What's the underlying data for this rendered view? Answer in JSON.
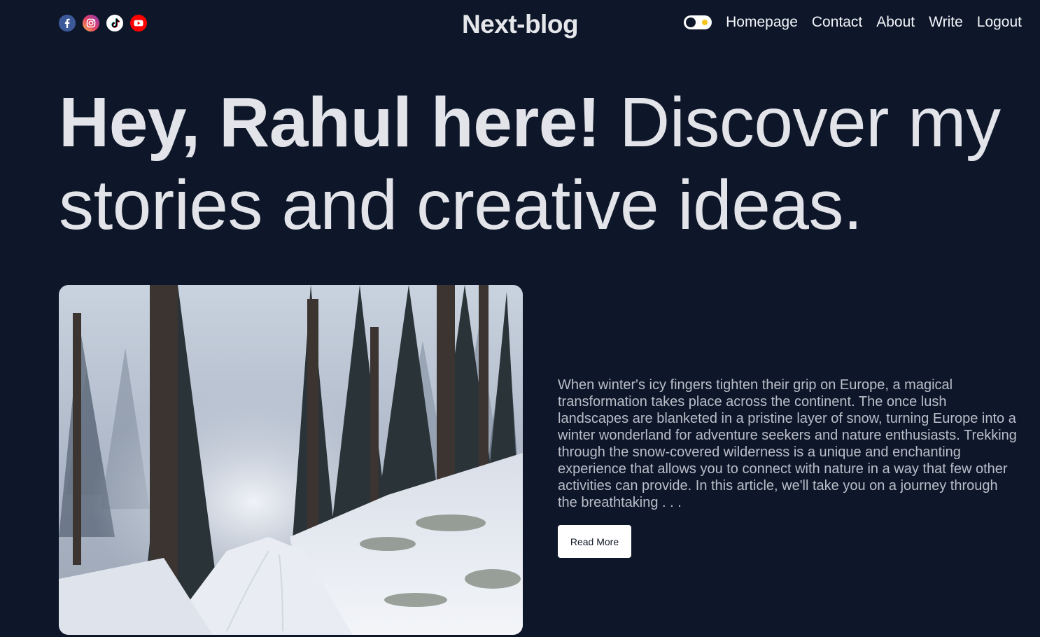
{
  "navbar": {
    "socials": [
      {
        "name": "facebook",
        "icon": "facebook-icon",
        "color": "#3b5998"
      },
      {
        "name": "instagram",
        "icon": "instagram-icon",
        "color": "#e1306c"
      },
      {
        "name": "tiktok",
        "icon": "tiktok-icon",
        "color": "#000000"
      },
      {
        "name": "youtube",
        "icon": "youtube-icon",
        "color": "#ff0000"
      }
    ],
    "logo": "Next-blog",
    "theme_toggle": {
      "state": "dark",
      "icon": "sun-icon"
    },
    "links": {
      "homepage": "Homepage",
      "contact": "Contact",
      "about": "About",
      "write": "Write",
      "logout": "Logout"
    }
  },
  "hero": {
    "bold": "Hey, Rahul here!",
    "rest": " Discover my stories and creative ideas."
  },
  "featured": {
    "image_alt": "snowy-forest-path-image",
    "excerpt": "When winter's icy fingers tighten their grip on Europe, a magical transformation takes place across the continent. The once lush landscapes are blanketed in a pristine layer of snow, turning Europe into a winter wonderland for adventure seekers and nature enthusiasts. Trekking through the snow-covered wilderness is a unique and enchanting experience that allows you to connect with nature in a way that few other activities can provide. In this article, we'll take you on a journey through the breathtaking . . .",
    "read_more": "Read More"
  },
  "colors": {
    "background": "#0e1629",
    "text": "#e2e4e9",
    "muted_text": "#b9bec8",
    "button_bg": "#ffffff"
  }
}
